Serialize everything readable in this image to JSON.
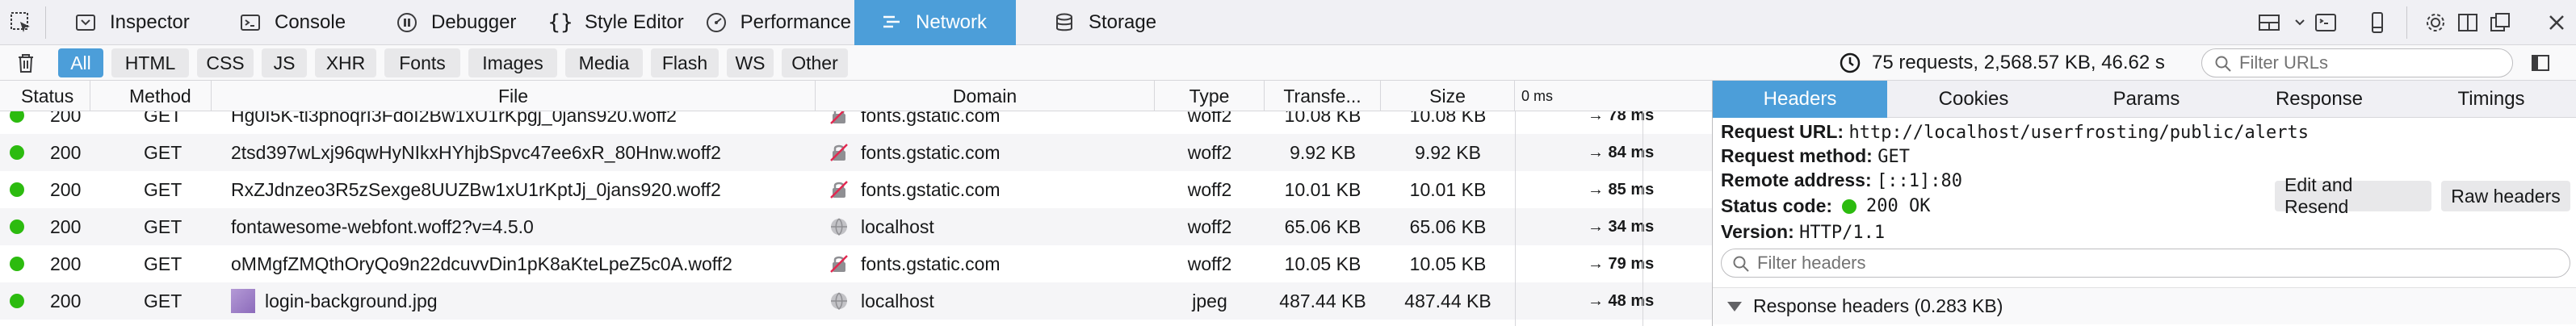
{
  "toolbar": {
    "tabs": [
      {
        "label": "Inspector",
        "icon": "inspector-icon",
        "selected": false
      },
      {
        "label": "Console",
        "icon": "console-icon",
        "selected": false
      },
      {
        "label": "Debugger",
        "icon": "debugger-icon",
        "selected": false
      },
      {
        "label": "Style Editor",
        "icon": "style-editor-icon",
        "selected": false
      },
      {
        "label": "Performance",
        "icon": "performance-icon",
        "selected": false
      },
      {
        "label": "Network",
        "icon": "network-icon",
        "selected": true
      },
      {
        "label": "Storage",
        "icon": "storage-icon",
        "selected": false
      }
    ],
    "right_icons": [
      "layout-icon",
      "split-console-icon",
      "responsive-icon",
      "settings-icon",
      "dock-side-icon",
      "separate-window-icon",
      "close-icon"
    ]
  },
  "filters": {
    "types": [
      "All",
      "HTML",
      "CSS",
      "JS",
      "XHR",
      "Fonts",
      "Images",
      "Media",
      "Flash",
      "WS",
      "Other"
    ],
    "selected": "All",
    "summary": "75 requests, 2,568.57 KB, 46.62 s",
    "url_placeholder": "Filter URLs"
  },
  "columns": {
    "status": "Status",
    "method": "Method",
    "file": "File",
    "domain": "Domain",
    "type": "Type",
    "transferred": "Transfe...",
    "size": "Size",
    "waterfall": "0 ms"
  },
  "rows": [
    {
      "status": "200",
      "method": "GET",
      "file": "Hg0I5K-tl3pnoqrI3FdoI2Bw1xU1rKpgj_0jans920.woff2",
      "domain": "fonts.gstatic.com",
      "domain_icon": "secure-broken-icon",
      "type": "woff2",
      "transferred": "10.08 KB",
      "size": "10.08 KB",
      "timing": "→ 78 ms",
      "bar_ms": 78
    },
    {
      "status": "200",
      "method": "GET",
      "file": "2tsd397wLxj96qwHyNIkxHYhjbSpvc47ee6xR_80Hnw.woff2",
      "domain": "fonts.gstatic.com",
      "domain_icon": "secure-broken-icon",
      "type": "woff2",
      "transferred": "9.92 KB",
      "size": "9.92 KB",
      "timing": "→ 84 ms",
      "bar_ms": 84
    },
    {
      "status": "200",
      "method": "GET",
      "file": "RxZJdnzeo3R5zSexge8UUZBw1xU1rKptJj_0jans920.woff2",
      "domain": "fonts.gstatic.com",
      "domain_icon": "secure-broken-icon",
      "type": "woff2",
      "transferred": "10.01 KB",
      "size": "10.01 KB",
      "timing": "→ 85 ms",
      "bar_ms": 85
    },
    {
      "status": "200",
      "method": "GET",
      "file": "fontawesome-webfont.woff2?v=4.5.0",
      "domain": "localhost",
      "domain_icon": "globe-icon",
      "type": "woff2",
      "transferred": "65.06 KB",
      "size": "65.06 KB",
      "timing": "→ 34 ms",
      "bar_ms": 34
    },
    {
      "status": "200",
      "method": "GET",
      "file": "oMMgfZMQthOryQo9n22dcuvvDin1pK8aKteLpeZ5c0A.woff2",
      "domain": "fonts.gstatic.com",
      "domain_icon": "secure-broken-icon",
      "type": "woff2",
      "transferred": "10.05 KB",
      "size": "10.05 KB",
      "timing": "→ 79 ms",
      "bar_ms": 79
    },
    {
      "status": "200",
      "method": "GET",
      "file": "login-background.jpg",
      "domain": "localhost",
      "domain_icon": "globe-icon",
      "type": "jpeg",
      "transferred": "487.44 KB",
      "size": "487.44 KB",
      "timing": "→ 48 ms",
      "bar_ms": 48,
      "thumbnail": true
    }
  ],
  "panel": {
    "tabs": [
      "Headers",
      "Cookies",
      "Params",
      "Response",
      "Timings"
    ],
    "selected": "Headers",
    "request_url_label": "Request URL:",
    "request_url": "http://localhost/userfrosting/public/alerts",
    "method_label": "Request method:",
    "method": "GET",
    "remote_label": "Remote address:",
    "remote": "[::1]:80",
    "status_label": "Status code:",
    "status": "200 OK",
    "version_label": "Version:",
    "version": "HTTP/1.1",
    "edit_resend": "Edit and Resend",
    "raw_headers": "Raw headers",
    "filter_placeholder": "Filter headers",
    "response_headers": "Response headers (0.283 KB)"
  },
  "colors": {
    "accent": "#4c9ed9",
    "status_ok": "#2cbb0f",
    "toolbar_bg": "#f0f0f4"
  }
}
